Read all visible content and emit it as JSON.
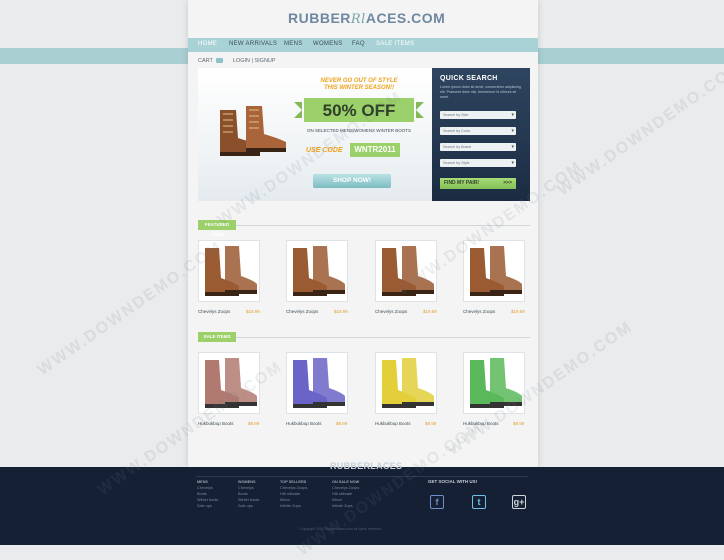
{
  "brand": {
    "logo_a": "RUBBER",
    "logo_b": "ACES.COM",
    "logo_script": "Rl"
  },
  "nav": [
    "HOME",
    "NEW ARRIVALS",
    "MENS",
    "WOMENS",
    "FAQ",
    "SALE ITEMS"
  ],
  "userbar": {
    "cart": "CART",
    "login": "LOGIN | SIGNUP"
  },
  "banner": {
    "tagline_1": "NEVER GO OUT OF STYLE",
    "tagline_2": "THIS WINTER SEASON!!",
    "offer": "50% OFF",
    "subtitle": "ON SELECTED MENS/WOMENS WINTER BOOTS",
    "code_label": "USE CODE",
    "code": "WNTR2011",
    "cta": "SHOP NOW!"
  },
  "quick_search": {
    "title": "QUICK SEARCH",
    "desc": "Lorem ipsum dolor sit amet, consectetur adipiscing elit. Praesent diam nisl, fermentum id ultrices sit amet.",
    "selects": [
      "Search by Size",
      "Search by Color",
      "Search by Brand",
      "Search by Style"
    ],
    "find": "FIND MY PAIR!",
    "find_go": ">>>"
  },
  "featured": {
    "label": "FEATURED ITEMS",
    "items": [
      {
        "name": "Chevelys Zoops",
        "price": "$19.99"
      },
      {
        "name": "Chevelys Zoops",
        "price": "$19.99"
      },
      {
        "name": "Chevelys Zoops",
        "price": "$19.99"
      },
      {
        "name": "Chevelys Zoops",
        "price": "$19.99"
      }
    ]
  },
  "sale": {
    "label": "SALE ITEMS",
    "items": [
      {
        "name": "Hukbukbup Boots",
        "price": "$9.99",
        "color": "#b07a70"
      },
      {
        "name": "Hukbukbup Boots",
        "price": "$9.99",
        "color": "#6b64c8"
      },
      {
        "name": "Hukbukbup Boots",
        "price": "$9.99",
        "color": "#e2cf3a"
      },
      {
        "name": "Hukbukbup Boots",
        "price": "$9.99",
        "color": "#5bb85a"
      }
    ]
  },
  "footer": {
    "logo": "RUBBERLACES",
    "columns": [
      {
        "head": "MENS",
        "items": [
          "Chevelys",
          "Boots",
          "Winter boots",
          "Sale ups"
        ]
      },
      {
        "head": "WOMENS",
        "items": [
          "Chevelys",
          "Boots",
          "Winter boots",
          "Sale ups"
        ]
      },
      {
        "head": "TOP SELLERS",
        "items": [
          "Chevelys Zoops",
          "Hitt ultimate",
          "Kifoot",
          "Infinite Zups"
        ]
      },
      {
        "head": "ON SALE NOW",
        "items": [
          "Chevelys Zoops",
          "Hitt ultimate",
          "Kifoot",
          "Infinite Zups"
        ]
      }
    ],
    "social_title": "GET SOCIAL WITH US!",
    "social": [
      {
        "icon": "facebook-icon",
        "glyph": "f",
        "color": "#6d8fc9"
      },
      {
        "icon": "twitter-icon",
        "glyph": "t",
        "color": "#6fc1e4"
      },
      {
        "icon": "googleplus-icon",
        "glyph": "g+",
        "color": "#cfd6de"
      }
    ],
    "copyright": "Copyright 2011 RubberLaces.com all rights reserved"
  },
  "watermark": "WWW.DOWNDEMO.COM",
  "colors": {
    "accent_green": "#9bd06a",
    "nav_teal": "#a9d2d6",
    "footer_navy": "#152035",
    "panel_navy": "#1b2c42",
    "price_orange": "#e0a030"
  }
}
